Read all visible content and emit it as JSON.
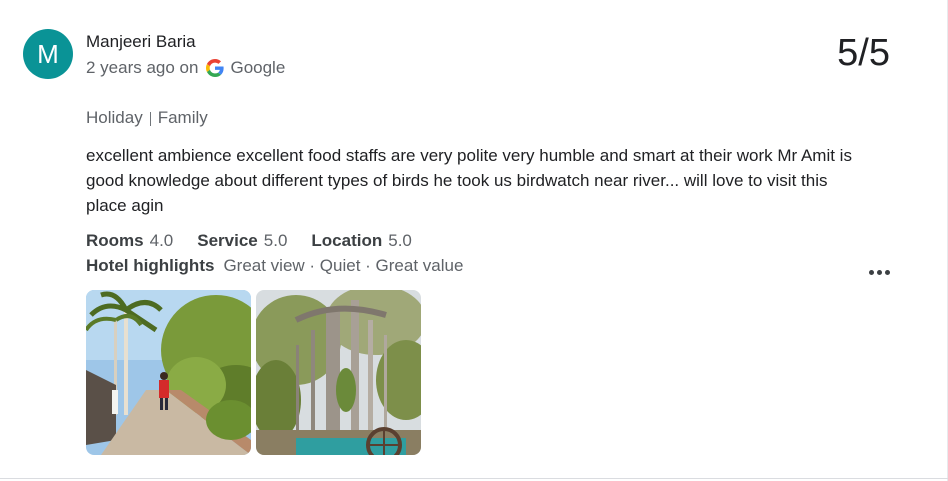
{
  "reviewer": {
    "initial": "M",
    "name": "Manjeeri Baria",
    "time": "2 years ago on",
    "source": "Google",
    "avatar_color": "#0a9396"
  },
  "score": "5/5",
  "tags": [
    "Holiday",
    "Family"
  ],
  "review_text": "excellent ambience excellent food staffs are very polite very humble and smart at their work Mr Amit is good knowledge about different types of birds he took us birdwatch near river... will love to visit this place agin",
  "ratings": [
    {
      "label": "Rooms",
      "value": "4.0"
    },
    {
      "label": "Service",
      "value": "5.0"
    },
    {
      "label": "Location",
      "value": "5.0"
    }
  ],
  "highlights": {
    "label": "Hotel highlights",
    "value": "Great view · Quiet · Great value"
  },
  "icons": {
    "google": "google-g-icon",
    "more": "more-options-icon"
  },
  "photos": [
    "photo-path-with-palms",
    "photo-banyan-tree"
  ]
}
